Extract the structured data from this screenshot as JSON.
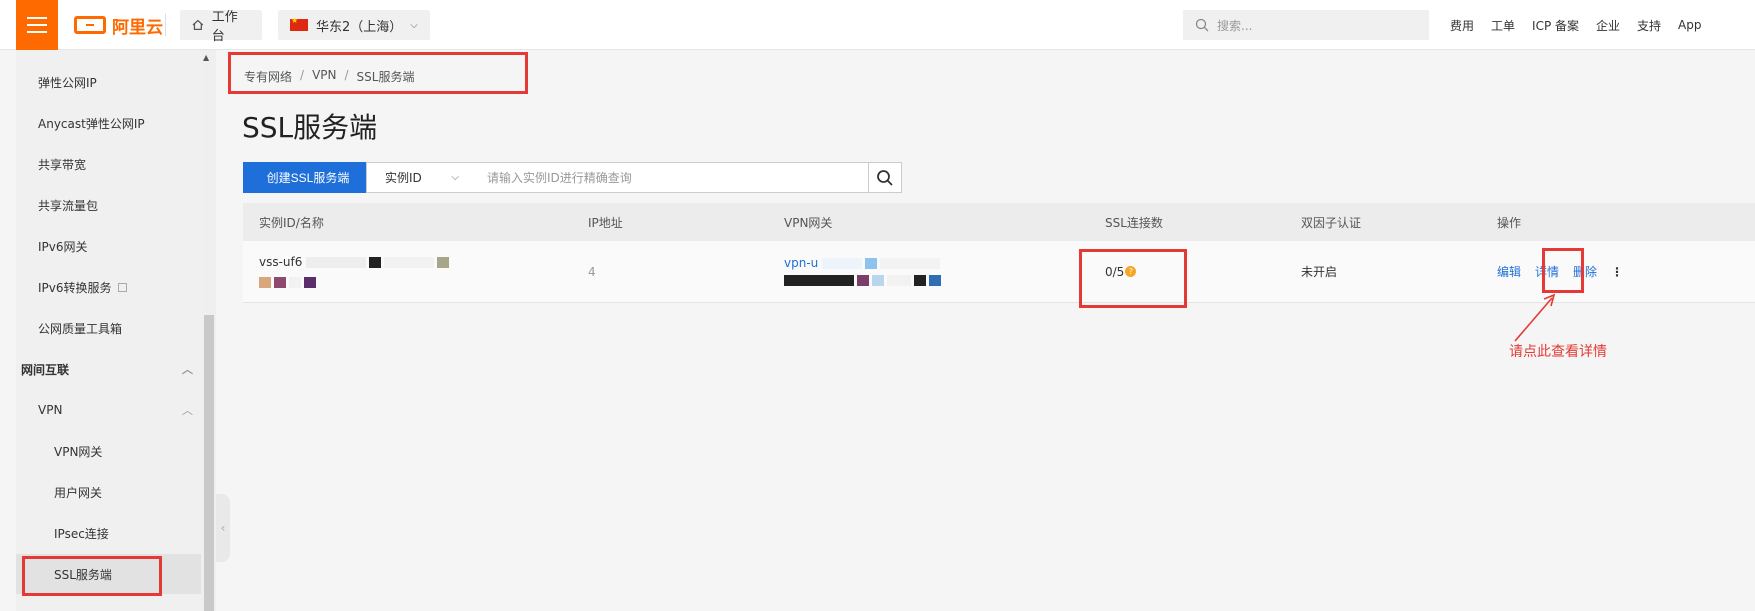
{
  "topbar": {
    "logo_text": "阿里云",
    "home_label": "工作台",
    "region_label": "华东2（上海）",
    "search_placeholder": "搜索...",
    "links": [
      "费用",
      "工单",
      "ICP 备案",
      "企业",
      "支持",
      "App"
    ]
  },
  "sidebar": {
    "items": [
      {
        "label": "弹性公网IP"
      },
      {
        "label": "Anycast弹性公网IP"
      },
      {
        "label": "共享带宽"
      },
      {
        "label": "共享流量包"
      },
      {
        "label": "IPv6网关"
      },
      {
        "label": "IPv6转换服务"
      },
      {
        "label": "公网质量工具箱"
      }
    ],
    "group_label": "网间互联",
    "subgroup_label": "VPN",
    "vpn_items": [
      {
        "label": "VPN网关"
      },
      {
        "label": "用户网关"
      },
      {
        "label": "IPsec连接"
      },
      {
        "label": "SSL服务端"
      }
    ]
  },
  "breadcrumb": [
    "专有网络",
    "VPN",
    "SSL服务端"
  ],
  "page_title": "SSL服务端",
  "toolbar": {
    "create_label": "创建SSL服务端",
    "select_value": "实例ID",
    "query_placeholder": "请输入实例ID进行精确查询"
  },
  "table": {
    "headers": [
      "实例ID/名称",
      "IP地址",
      "VPN网关",
      "SSL连接数",
      "双因子认证",
      "操作"
    ],
    "rows": [
      {
        "instance_id": "vss-uf6",
        "ip": "4",
        "vpn_gateway": "vpn-u",
        "ssl_connections": "0/5",
        "two_factor": "未开启",
        "actions": [
          "编辑",
          "详情",
          "删除"
        ]
      }
    ]
  },
  "annotation": {
    "text": "请点此查看详情"
  },
  "colors": {
    "brand": "#ff6a00",
    "primary": "#1e6fd9",
    "highlight": "#e53935"
  }
}
